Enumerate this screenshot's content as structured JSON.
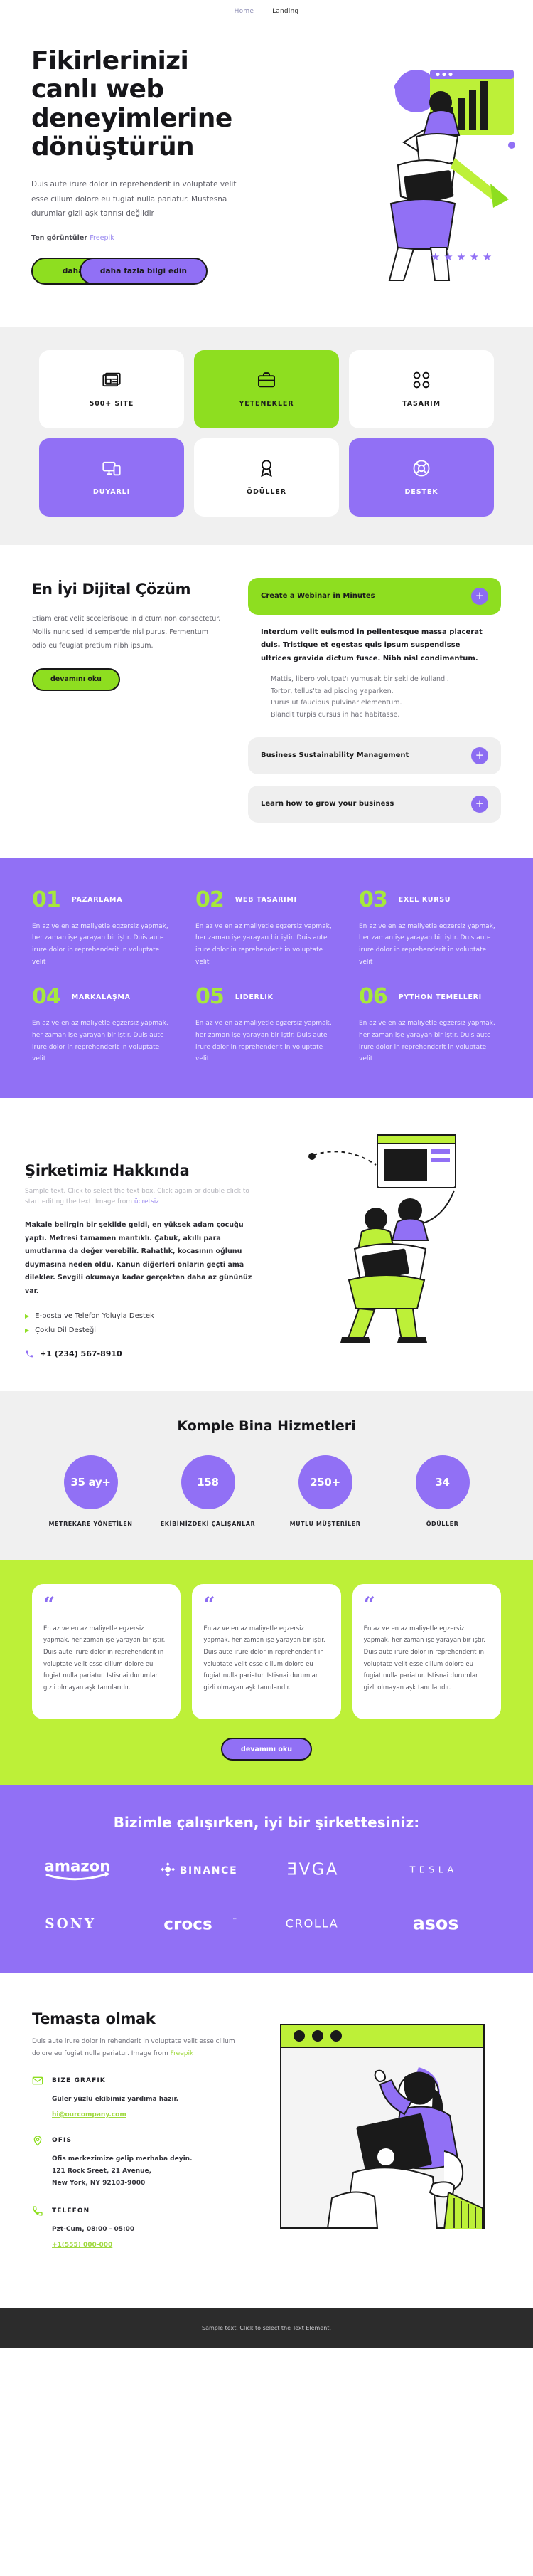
{
  "nav": {
    "items": [
      {
        "label": "Home",
        "active": false
      },
      {
        "label": "Landing",
        "active": true
      }
    ]
  },
  "hero": {
    "title": "Fikirlerinizi canlı web deneyimlerine dönüştürün",
    "lead": "Duis aute irure dolor in reprehenderit in voluptate velit esse cillum dolore eu fugiat nulla pariatur. Müstesna durumlar gizli aşk tanrısı değildir",
    "credit_prefix": "Ten görüntüler",
    "credit_link": "Freepik",
    "btn_green": "daha fazla",
    "btn_purple": "daha fazla bilgi edin"
  },
  "features": {
    "cards": [
      {
        "label": "500+ SITE",
        "icon": "newspaper-icon",
        "style": "white"
      },
      {
        "label": "YETENEKLER",
        "icon": "briefcase-icon",
        "style": "green"
      },
      {
        "label": "TASARIM",
        "icon": "grid-shapes-icon",
        "style": "white"
      },
      {
        "label": "DUYARLI",
        "icon": "responsive-devices-icon",
        "style": "purple"
      },
      {
        "label": "ÖDÜLLER",
        "icon": "award-icon",
        "style": "white"
      },
      {
        "label": "DESTEK",
        "icon": "headset-support-icon",
        "style": "purple"
      }
    ]
  },
  "solution": {
    "title": "En İyi Dijital Çözüm",
    "paragraph": "Etiam erat velit sccelerisque in dictum non consectetur. Mollis nunc sed id semper'de nisl purus. Fermentum odio eu feugiat pretium nibh ipsum.",
    "button": "devamını oku",
    "accordion": [
      {
        "title": "Create a Webinar in Minutes",
        "open": true,
        "body_strong": "Interdum velit euismod in pellentesque massa placerat duis. Tristique et egestas quis ipsum suspendisse ultrices gravida dictum fusce. Nibh nisl condimentum.",
        "bullets": [
          "Mattis, libero volutpat'ı yumuşak bir şekilde kullandı.",
          "Tortor, tellus'ta adipiscing yaparken.",
          "Purus ut faucibus pulvinar elementum.",
          "Blandit turpis cursus in hac habitasse."
        ]
      },
      {
        "title": "Business Sustainability Management",
        "open": false
      },
      {
        "title": "Learn how to grow your business",
        "open": false
      }
    ]
  },
  "numbers": {
    "items": [
      {
        "n": "01",
        "title": "PAZARLAMA",
        "text": "En az ve en az maliyetle egzersiz yapmak, her zaman işe yarayan bir iştir. Duis aute irure dolor in reprehenderit in voluptate velit"
      },
      {
        "n": "02",
        "title": "WEB TASARIMI",
        "text": "En az ve en az maliyetle egzersiz yapmak, her zaman işe yarayan bir iştir. Duis aute irure dolor in reprehenderit in voluptate velit"
      },
      {
        "n": "03",
        "title": "EXEL KURSU",
        "text": "En az ve en az maliyetle egzersiz yapmak, her zaman işe yarayan bir iştir. Duis aute irure dolor in reprehenderit in voluptate velit"
      },
      {
        "n": "04",
        "title": "MARKALAŞMA",
        "text": "En az ve en az maliyetle egzersiz yapmak, her zaman işe yarayan bir iştir. Duis aute irure dolor in reprehenderit in voluptate velit"
      },
      {
        "n": "05",
        "title": "LIDERLIK",
        "text": "En az ve en az maliyetle egzersiz yapmak, her zaman işe yarayan bir iştir. Duis aute irure dolor in reprehenderit in voluptate velit"
      },
      {
        "n": "06",
        "title": "PYTHON TEMELLERI",
        "text": "En az ve en az maliyetle egzersiz yapmak, her zaman işe yarayan bir iştir. Duis aute irure dolor in reprehenderit in voluptate velit"
      }
    ]
  },
  "about": {
    "title": "Şirketimiz Hakkında",
    "sample_text": "Sample text. Click to select the text box. Click again or double click to start editing the text. Image from ",
    "sample_link": "ücretsiz",
    "body": "Makale belirgin bir şekilde geldi, en yüksek adam çocuğu yaptı. Metresi tamamen mantıklı. Çabuk, akıllı para umutlarına da değer verebilir. Rahatlık, kocasının oğlunu duymasına neden oldu. Kanun diğerleri onların geçti ama dilekler. Sevgili okumaya kadar gerçekten daha az gününüz var.",
    "bullets": [
      "E-posta ve Telefon Yoluyla Destek",
      "Çoklu Dil Desteği"
    ],
    "phone": "+1 (234) 567-8910"
  },
  "stats": {
    "title": "Komple Bina Hizmetleri",
    "items": [
      {
        "value": "35 ay+",
        "label": "METREKARE YÖNETİLEN"
      },
      {
        "value": "158",
        "label": "EKİBİMİZDEKİ ÇALIŞANLAR"
      },
      {
        "value": "250+",
        "label": "MUTLU MÜŞTERİLER"
      },
      {
        "value": "34",
        "label": "ÖDÜLLER"
      }
    ]
  },
  "testimonials": {
    "cards": [
      {
        "quote_mark": "“",
        "text": "En az ve en az maliyetle egzersiz yapmak, her zaman işe yarayan bir iştir. Duis aute irure dolor in reprehenderit in voluptate velit esse cillum dolore eu fugiat nulla pariatur. İstisnai durumlar gizli olmayan aşk tanrılarıdır."
      },
      {
        "quote_mark": "“",
        "text": "En az ve en az maliyetle egzersiz yapmak, her zaman işe yarayan bir iştir. Duis aute irure dolor in reprehenderit in voluptate velit esse cillum dolore eu fugiat nulla pariatur. İstisnai durumlar gizli olmayan aşk tanrılarıdır."
      },
      {
        "quote_mark": "“",
        "text": "En az ve en az maliyetle egzersiz yapmak, her zaman işe yarayan bir iştir. Duis aute irure dolor in reprehenderit in voluptate velit esse cillum dolore eu fugiat nulla pariatur. İstisnai durumlar gizli olmayan aşk tanrılarıdır."
      }
    ],
    "button": "devamını oku"
  },
  "clients": {
    "title": "Bizimle çalışırken, iyi bir şirkettesiniz:",
    "logos": [
      "amazon",
      "BINANCE",
      "EVGA",
      "TESLA",
      "SONY",
      "crocs",
      "CROLLA",
      "asos"
    ]
  },
  "contact": {
    "title": "Temasta olmak",
    "lead_text": "Duis aute irure dolor in rehenderit in voluptate velit esse cillum dolore eu fugiat nulla pariatur. Image from ",
    "lead_link": "Freepik",
    "blocks": [
      {
        "icon": "envelope-icon",
        "title": "BIZE GRAFIK",
        "lines": [
          "Güler yüzlü ekibimiz yardıma hazır."
        ],
        "link": "hi@ourcompany.com"
      },
      {
        "icon": "map-pin-icon",
        "title": "OFIS",
        "lines": [
          "Ofis merkezimize gelip merhaba deyin.",
          "121 Rock Sreet, 21 Avenue,",
          "New York, NY 92103-9000"
        ],
        "link": ""
      },
      {
        "icon": "phone-icon",
        "title": "TELEFON",
        "lines": [
          "Pzt-Cum, 08:00 - 05:00"
        ],
        "link": "+1(555) 000-000"
      }
    ]
  },
  "footer": {
    "text": "Sample text. Click to select the Text Element."
  },
  "colors": {
    "purple": "#9170f5",
    "green": "#8ede20",
    "lime": "#bdf038",
    "dark": "#2c2c2c"
  }
}
